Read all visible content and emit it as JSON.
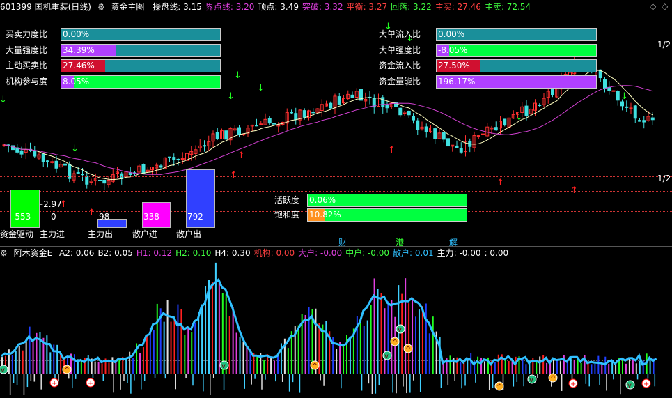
{
  "top_header": {
    "code_name": "601399 国机重装(日线)",
    "indicator": "资金主图",
    "items": [
      {
        "label": "操盘线:",
        "value": "3.15",
        "color": "#ffffff"
      },
      {
        "label": "界点线:",
        "value": "3.20",
        "color": "#e040e0"
      },
      {
        "label": "顶点:",
        "value": "3.49",
        "color": "#ffffff"
      },
      {
        "label": "突破:",
        "value": "3.32",
        "color": "#e040e0"
      },
      {
        "label": "平衡:",
        "value": "3.27",
        "color": "#ff4040"
      },
      {
        "label": "回落:",
        "value": "3.22",
        "color": "#40ff40"
      },
      {
        "label": "主买:",
        "value": "27.46",
        "color": "#ff4040"
      },
      {
        "label": "主卖:",
        "value": "72.54",
        "color": "#40ff40"
      }
    ]
  },
  "left_bars": [
    {
      "label": "买卖力度比",
      "value": "0.00%",
      "fill": 0.0,
      "color": "#00ff00"
    },
    {
      "label": "大量强度比",
      "value": "34.39%",
      "fill": 0.3439,
      "color": "#b040ff"
    },
    {
      "label": "主动买卖比",
      "value": "27.46%",
      "fill": 0.2746,
      "color": "#d01030"
    },
    {
      "label": "机构参与度",
      "value": "8.05%",
      "fill": 0.0805,
      "color": "#b040ff",
      "rest": "#00ff40"
    }
  ],
  "right_bars": [
    {
      "label": "大单流入比",
      "value": "0.00%",
      "fill": 0.0,
      "color": "#00ff00"
    },
    {
      "label": "大单强度比",
      "value": "-8.05%",
      "fill": 0.0805,
      "color": "#b040ff",
      "rest": "#00ff40"
    },
    {
      "label": "资金流入比",
      "value": "27.50%",
      "fill": 0.275,
      "color": "#d01030"
    },
    {
      "label": "资金量能比",
      "value": "196.17%",
      "fill": 1.0,
      "color": "#b040ff"
    }
  ],
  "scale_labels": {
    "upper": "1/2",
    "lower": "1/2"
  },
  "price_marker": "2.97",
  "fund_columns": [
    {
      "label": "资金驱动",
      "value": "-553",
      "level": 0.3,
      "color": "#00ff00"
    },
    {
      "label": "主力进",
      "value": "0",
      "level": 0.0,
      "color": "#ff2020"
    },
    {
      "label": "主力出",
      "value": "98",
      "level": 0.06,
      "color": "#3040ff"
    },
    {
      "label": "散户进",
      "value": "338",
      "level": 0.2,
      "color": "#ff00ff"
    },
    {
      "label": "散户出",
      "value": "792",
      "level": 0.47,
      "color": "#3040ff"
    }
  ],
  "activity_bars": [
    {
      "label": "活跃度",
      "value": "0.06%",
      "fill": 0.0,
      "color": "#00ff40"
    },
    {
      "label": "饱和度",
      "value": "10.82%",
      "fill": 0.1082,
      "color": "#ff9020",
      "rest": "#00ff40"
    }
  ],
  "bottom_tags": [
    {
      "text": "财",
      "color": "#30c0ff"
    },
    {
      "text": "港",
      "color": "#30ff30"
    },
    {
      "text": "解",
      "color": "#30c0ff"
    }
  ],
  "sub_header": {
    "name": "阿木资金E",
    "items": [
      {
        "label": "A2:",
        "value": "0.06",
        "color": "#ffffff"
      },
      {
        "label": "B2:",
        "value": "0.05",
        "color": "#ffffff"
      },
      {
        "label": "H1:",
        "value": "0.12",
        "color": "#e040e0"
      },
      {
        "label": "H2:",
        "value": "0.10",
        "color": "#40ff40"
      },
      {
        "label": "H4:",
        "value": "0.30",
        "color": "#ffffff"
      },
      {
        "label": "机构:",
        "value": "0.00",
        "color": "#ff4040"
      },
      {
        "label": "大户:",
        "value": "-0.00",
        "color": "#e040e0"
      },
      {
        "label": "中户:",
        "value": "-0.00",
        "color": "#40ff40"
      },
      {
        "label": "散户:",
        "value": "0.01",
        "color": "#30c0ff"
      },
      {
        "label": "主力:",
        "value": "-0.00",
        "color": "#ffffff"
      },
      {
        "label": ":",
        "value": "0.00",
        "color": "#ffffff"
      }
    ]
  },
  "icons": [
    "settings-gear-icon",
    "diamond-up-icon",
    "diamond-down-icon",
    "up-arrow-icon",
    "down-arrow-icon",
    "cross-circle-icon"
  ]
}
